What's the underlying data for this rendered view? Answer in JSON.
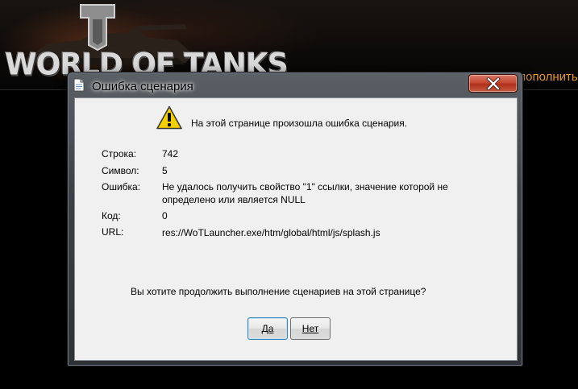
{
  "launcher": {
    "logo_text": "WORLD OF TANKS",
    "top_up_label": "пополнить"
  },
  "dialog": {
    "title": "Ошибка сценария",
    "message": "На этой странице произошла ошибка сценария.",
    "details": {
      "line_label": "Строка:",
      "line_value": "742",
      "char_label": "Символ:",
      "char_value": "5",
      "error_label": "Ошибка:",
      "error_value": "Не удалось получить свойство \"1\" ссылки, значение которой не определено или является NULL",
      "code_label": "Код:",
      "code_value": "0",
      "url_label": "URL:",
      "url_value": "res://WoTLauncher.exe/htm/global/html/js/splash.js"
    },
    "question": "Вы хотите продолжить выполнение сценариев на этой странице?",
    "buttons": {
      "yes_label": "Да",
      "no_label": "Нет"
    },
    "icons": {
      "title": "document-icon",
      "warning": "warning-icon",
      "close": "close-icon"
    }
  },
  "colors": {
    "top_up": "#e59a2e",
    "close_button": "#c74a34",
    "warning_yellow": "#f5d000"
  }
}
